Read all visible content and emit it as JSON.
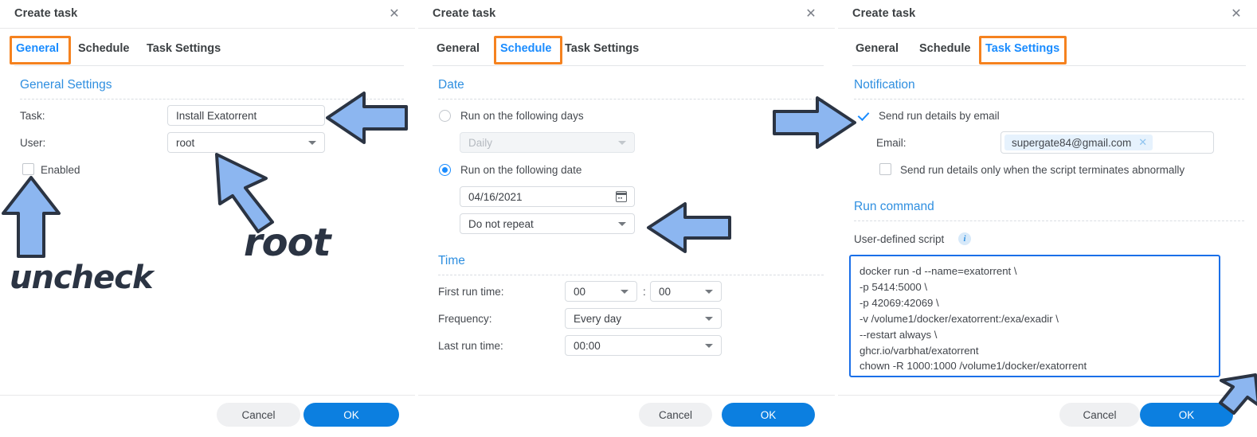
{
  "colors": {
    "accent_blue": "#1a8cff",
    "heading_blue": "#2f8fe0",
    "highlight_orange": "#f5821f",
    "ok_button": "#0c7fe0",
    "arrow_fill": "#8cb6f0",
    "arrow_stroke": "#2b3443"
  },
  "panels": [
    {
      "id": "general",
      "title": "Create task",
      "close_icon": "close-icon",
      "tabs": [
        {
          "label": "General",
          "active": true,
          "highlighted": true
        },
        {
          "label": "Schedule",
          "active": false,
          "highlighted": false
        },
        {
          "label": "Task Settings",
          "active": false,
          "highlighted": false
        }
      ],
      "section": "General Settings",
      "fields": {
        "task_label": "Task:",
        "task_value": "Install Exatorrent",
        "user_label": "User:",
        "user_value": "root",
        "enabled_label": "Enabled",
        "enabled_checked": false
      },
      "footer": {
        "cancel": "Cancel",
        "ok": "OK"
      }
    },
    {
      "id": "schedule",
      "title": "Create task",
      "close_icon": "close-icon",
      "tabs": [
        {
          "label": "General",
          "active": false,
          "highlighted": false
        },
        {
          "label": "Schedule",
          "active": true,
          "highlighted": true
        },
        {
          "label": "Task Settings",
          "active": false,
          "highlighted": false
        }
      ],
      "date_section": "Date",
      "time_section": "Time",
      "date": {
        "run_days_label": "Run on the following days",
        "run_days_selected": false,
        "daily_value": "Daily",
        "daily_disabled": true,
        "run_date_label": "Run on the following date",
        "run_date_selected": true,
        "date_value": "04/16/2021",
        "repeat_value": "Do not repeat"
      },
      "time": {
        "first_run_label": "First run time:",
        "first_run_hour": "00",
        "first_run_separator": ":",
        "first_run_minute": "00",
        "frequency_label": "Frequency:",
        "frequency_value": "Every day",
        "last_run_label": "Last run time:",
        "last_run_value": "00:00"
      },
      "footer": {
        "cancel": "Cancel",
        "ok": "OK"
      }
    },
    {
      "id": "task-settings",
      "title": "Create task",
      "close_icon": "close-icon",
      "tabs": [
        {
          "label": "General",
          "active": false,
          "highlighted": false
        },
        {
          "label": "Schedule",
          "active": false,
          "highlighted": false
        },
        {
          "label": "Task Settings",
          "active": true,
          "highlighted": true
        }
      ],
      "notification_section": "Notification",
      "notification": {
        "send_email_label": "Send run details by email",
        "send_email_checked": true,
        "email_label": "Email:",
        "email_chip": "supergate84@gmail.com",
        "email_chip_remove_icon": "close-icon",
        "abnormal_label": "Send run details only when the script terminates abnormally",
        "abnormal_checked": false
      },
      "run_command_section": "Run command",
      "script": {
        "label": "User-defined script",
        "info_icon": "info-icon",
        "lines": [
          "docker run -d --name=exatorrent \\",
          "-p 5414:5000 \\",
          "-p 42069:42069 \\",
          "-v /volume1/docker/exatorrent:/exa/exadir \\",
          "--restart always \\",
          "ghcr.io/varbhat/exatorrent",
          "chown -R 1000:1000 /volume1/docker/exatorrent"
        ]
      },
      "footer": {
        "cancel": "Cancel",
        "ok": "OK"
      }
    }
  ],
  "annotations": {
    "uncheck_text": "uncheck",
    "root_text": "root",
    "arrows": [
      {
        "name": "arrow-to-task-field",
        "direction": "left"
      },
      {
        "name": "arrow-to-user-dropdown",
        "direction": "up-left"
      },
      {
        "name": "arrow-to-enabled-checkbox",
        "direction": "up"
      },
      {
        "name": "arrow-to-repeat-dropdown",
        "direction": "left"
      },
      {
        "name": "arrow-to-send-email-checkbox",
        "direction": "right"
      },
      {
        "name": "arrow-to-ok-button",
        "direction": "down-left"
      }
    ]
  }
}
